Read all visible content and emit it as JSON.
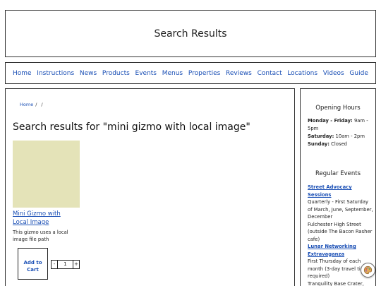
{
  "header": {
    "title": "Search Results"
  },
  "nav": {
    "items": [
      "Home",
      "Instructions",
      "News",
      "Products",
      "Events",
      "Menus",
      "Properties",
      "Reviews",
      "Contact",
      "Locations",
      "Videos",
      "Guide"
    ]
  },
  "breadcrumb": {
    "home": "Home",
    "sep1": "/",
    "sep2": "/"
  },
  "main": {
    "title": "Search results for \"mini gizmo with local image\"",
    "product": {
      "name": "Mini Gizmo with Local Image",
      "description": "This gizmo uses a local image file path",
      "add_to_cart": "Add to Cart",
      "quantity": "1",
      "minus": "-",
      "plus": "+"
    }
  },
  "sidebar": {
    "hours_heading": "Opening Hours",
    "hours": [
      {
        "days": "Monday - Friday:",
        "time": " 9am - 5pm"
      },
      {
        "days": "Saturday:",
        "time": " 10am - 2pm"
      },
      {
        "days": "Sunday:",
        "time": " Closed"
      }
    ],
    "events_heading": "Regular Events",
    "events": [
      {
        "name": "Street Advocacy Sessions",
        "schedule": "Quarterly - First Saturday of March, June, September, December",
        "location": "Fulchester High Street (outside The Bacon Rasher cafe)"
      },
      {
        "name": "Lunar Networking Extravaganza",
        "schedule": "First Thursday of each month (3-day travel time required)",
        "location": "Tranquility Base Crater, The Moon"
      }
    ]
  },
  "colors": {
    "link": "#1a4fb5",
    "image_placeholder": "#e4e3b8"
  },
  "icons": {
    "floating": "palette-icon"
  }
}
